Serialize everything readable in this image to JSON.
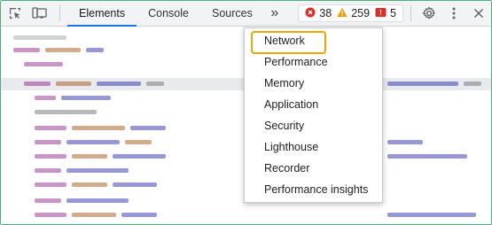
{
  "toolbar": {
    "icons": {
      "inspect": "inspect-element-icon",
      "device": "device-toolbar-icon",
      "more_tabs": "double-chevron-right-icon",
      "settings": "gear-icon",
      "menu": "vertical-dots-icon",
      "close": "close-icon"
    },
    "tabs": [
      {
        "label": "Elements",
        "active": true
      },
      {
        "label": "Console",
        "active": false
      },
      {
        "label": "Sources",
        "active": false
      }
    ],
    "more_tabs_glyph": "»",
    "counters": {
      "errors": "38",
      "warnings": "259",
      "issues": "5"
    },
    "colors": {
      "error": "#d93025",
      "warning": "#f29900",
      "issue": "#d93025",
      "active_tab": "#1a73e8"
    }
  },
  "menu": {
    "items": [
      {
        "label": "Network",
        "focused": true
      },
      {
        "label": "Performance",
        "focused": false
      },
      {
        "label": "Memory",
        "focused": false
      },
      {
        "label": "Application",
        "focused": false
      },
      {
        "label": "Security",
        "focused": false
      },
      {
        "label": "Lighthouse",
        "focused": false
      },
      {
        "label": "Recorder",
        "focused": false
      },
      {
        "label": "Performance insights",
        "focused": false
      }
    ],
    "focus_color": "#f0a30a"
  }
}
